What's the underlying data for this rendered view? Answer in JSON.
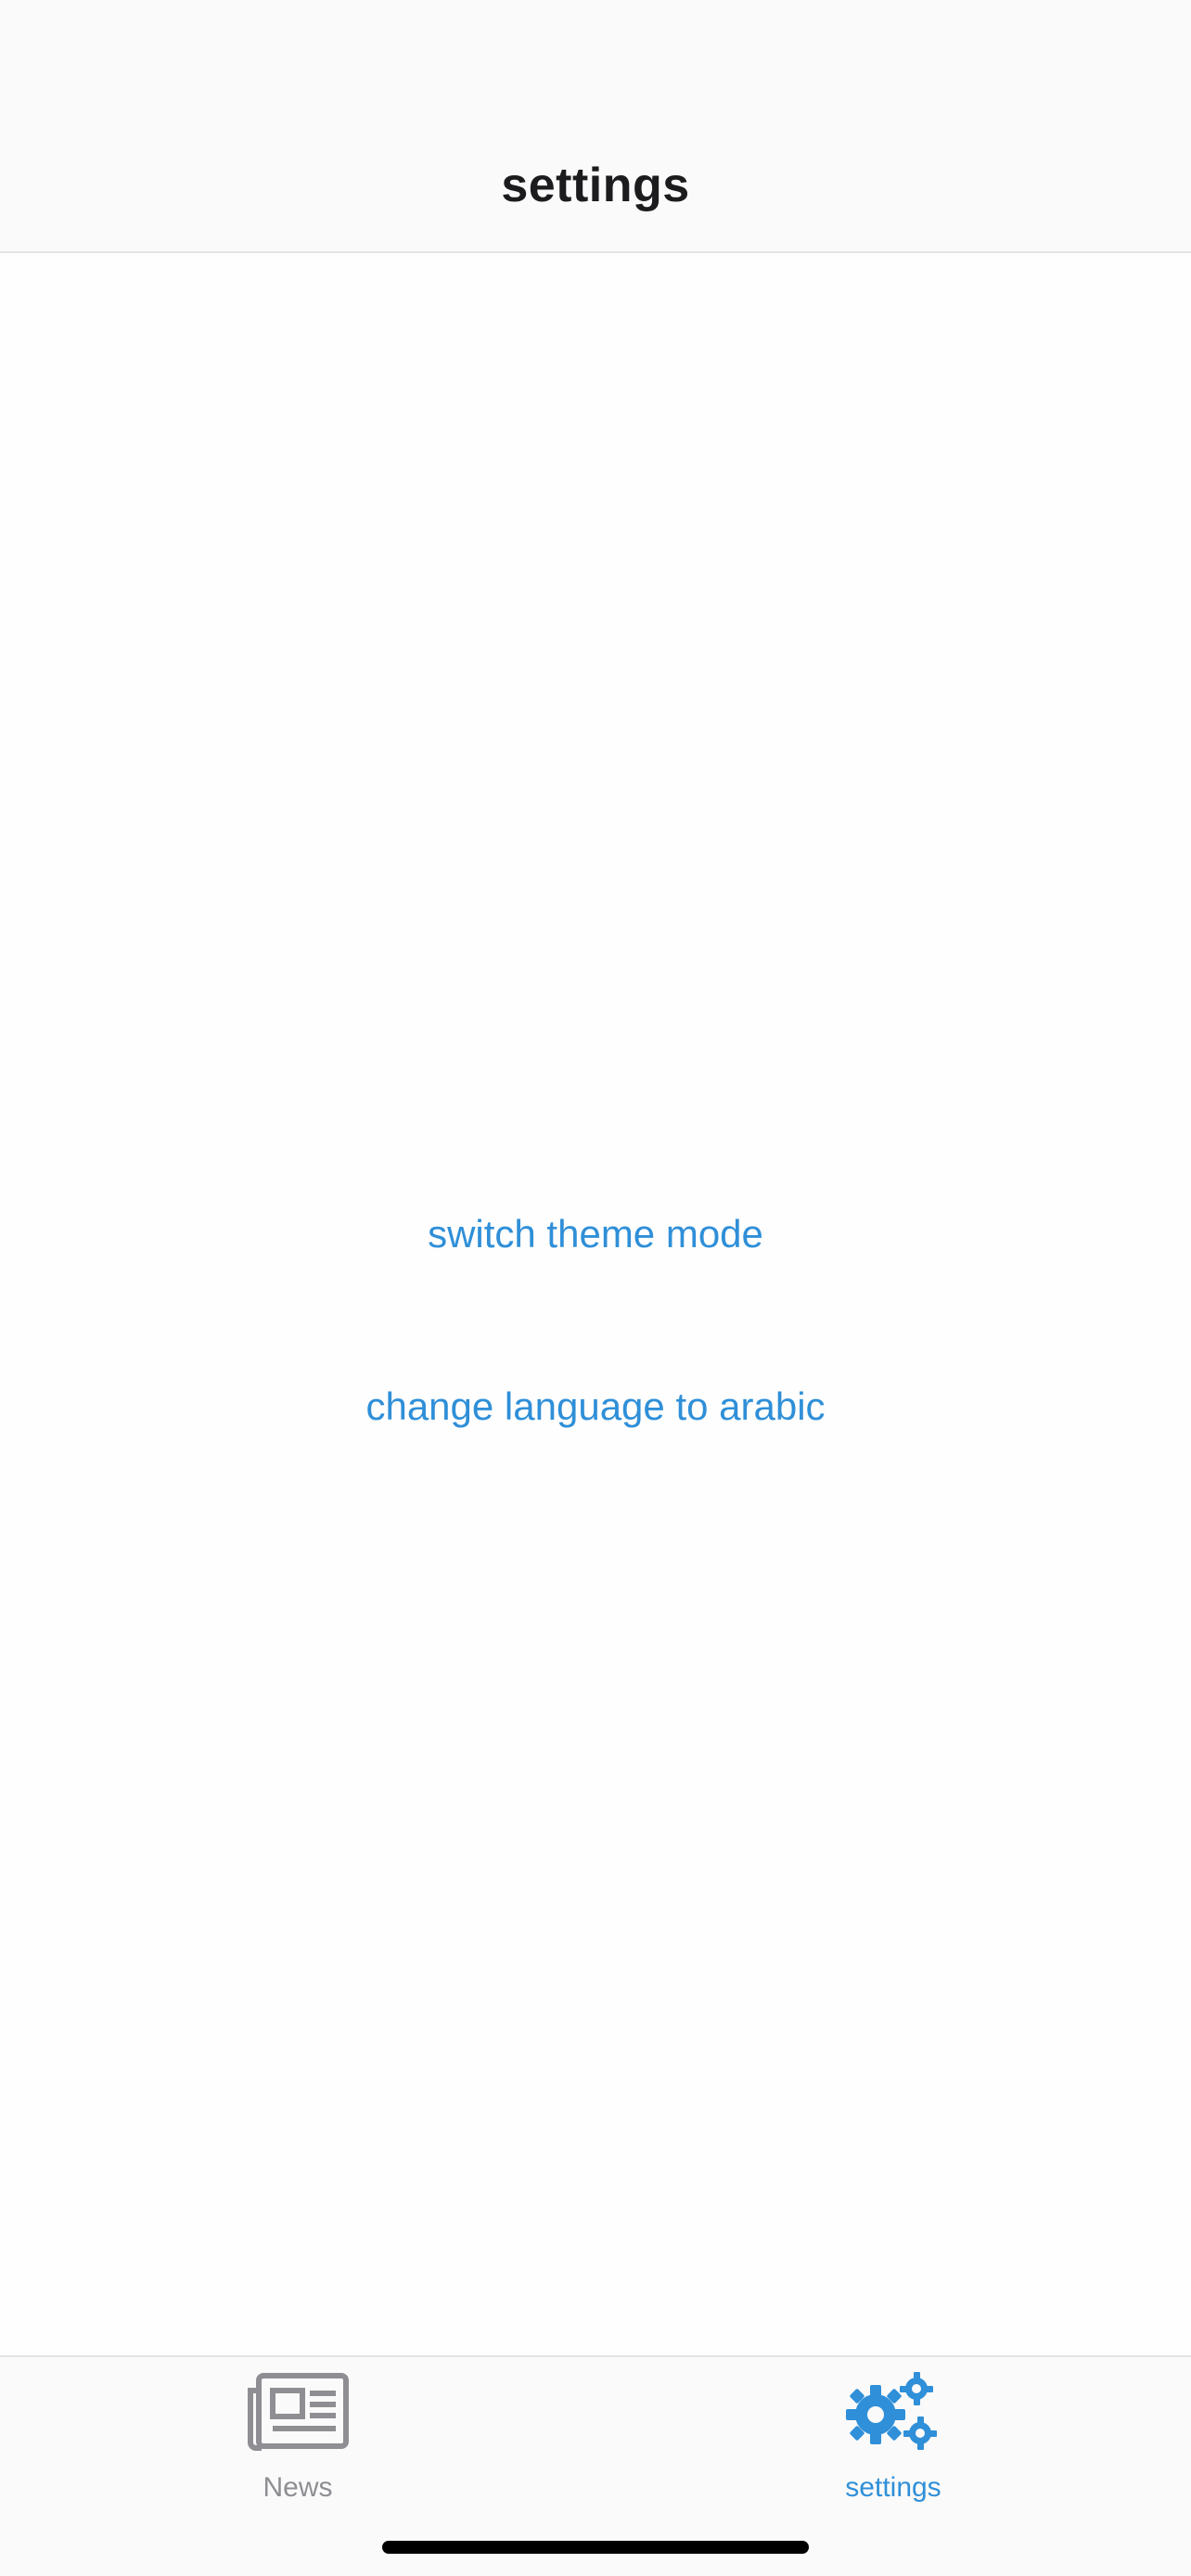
{
  "header": {
    "title": "settings"
  },
  "main": {
    "switch_theme_label": "switch theme mode",
    "change_language_label": "change language to arabic"
  },
  "tabbar": {
    "tabs": [
      {
        "label": "News",
        "icon": "newspaper-icon",
        "active": false
      },
      {
        "label": "settings",
        "icon": "gears-icon",
        "active": true
      }
    ]
  },
  "colors": {
    "accent": "#2f8fd8",
    "inactive": "#8e8e93",
    "title": "#1c1c1e"
  }
}
